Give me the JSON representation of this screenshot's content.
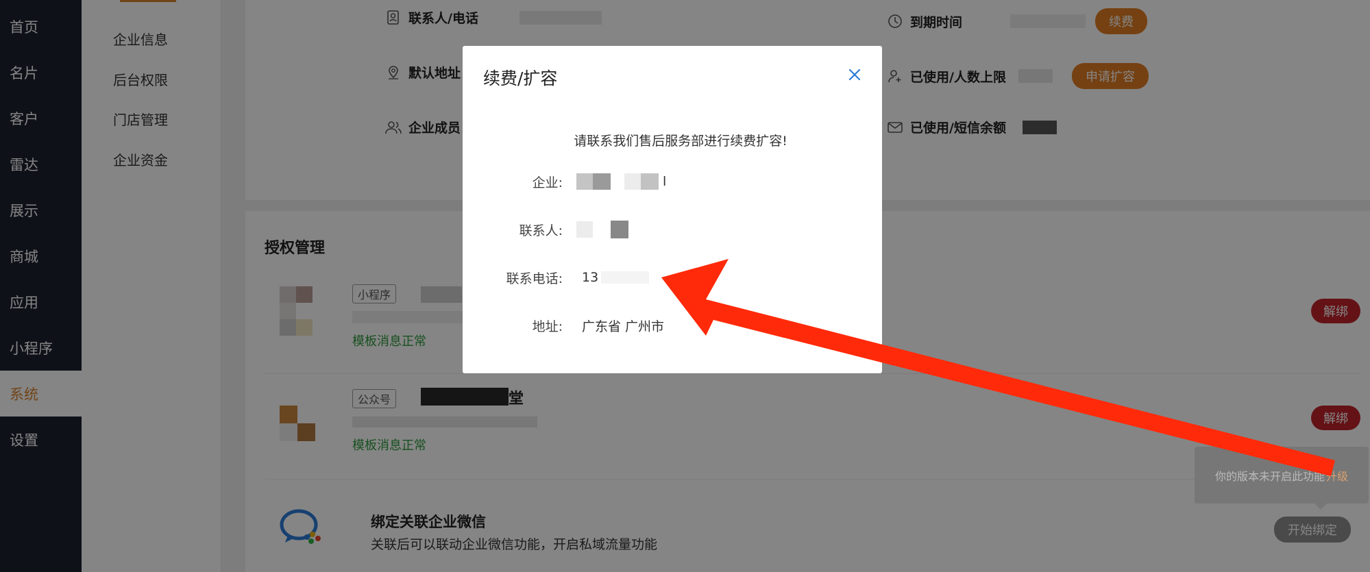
{
  "nav": {
    "items": [
      {
        "label": "首页"
      },
      {
        "label": "名片"
      },
      {
        "label": "客户"
      },
      {
        "label": "雷达"
      },
      {
        "label": "展示"
      },
      {
        "label": "商城"
      },
      {
        "label": "应用"
      },
      {
        "label": "小程序"
      },
      {
        "label": "系统"
      },
      {
        "label": "设置"
      }
    ],
    "active": "系统"
  },
  "subnav": {
    "items": [
      {
        "label": "企业信息"
      },
      {
        "label": "后台权限"
      },
      {
        "label": "门店管理"
      },
      {
        "label": "企业资金"
      }
    ]
  },
  "info": {
    "contact_label": "联系人/电话",
    "expire_label": "到期时间",
    "renew_button": "续费",
    "address_label": "默认地址",
    "users_label": "已使用/人数上限",
    "expand_button": "申请扩容",
    "members_label": "企业成员",
    "sms_label": "已使用/短信余额"
  },
  "auth": {
    "title": "授权管理",
    "miniprogram": {
      "tag": "小程序",
      "status": "模板消息正常",
      "unbind": "解绑"
    },
    "official": {
      "tag": "公众号",
      "suffix": "堂",
      "status": "模板消息正常",
      "unbind": "解绑"
    },
    "wecom": {
      "title": "绑定关联企业微信",
      "subtitle": "关联后可以联动企业微信功能，开启私域流量功能",
      "bind": "开始绑定"
    }
  },
  "tooltip": {
    "text": "你的版本未开启此功能",
    "link": "升级"
  },
  "modal": {
    "title": "续费/扩容",
    "message": "请联系我们售后服务部进行续费扩容!",
    "company_label": "企业:",
    "company_value_tail": "l",
    "contact_label": "联系人:",
    "phone_label": "联系电话:",
    "phone_value": "13",
    "address_label": "地址:",
    "address_value": "广东省 广州市"
  },
  "colors": {
    "nav_bg": "#1d2130",
    "accent": "#e07d23",
    "danger": "#c0232b",
    "success": "#2e9a3c",
    "arrow": "#ff2a0a"
  }
}
